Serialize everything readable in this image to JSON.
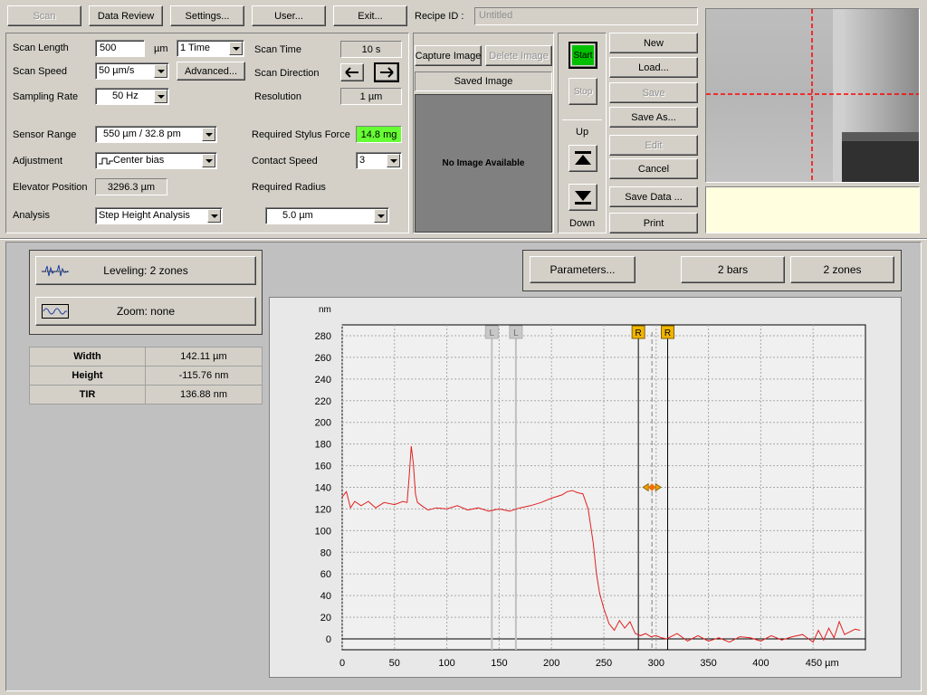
{
  "toolbar": {
    "scan": "Scan",
    "data_review": "Data Review",
    "settings": "Settings...",
    "user": "User...",
    "exit": "Exit...",
    "recipe_label": "Recipe ID :",
    "recipe_value": "Untitled"
  },
  "params": {
    "scan_length_label": "Scan Length",
    "scan_length_value": "500",
    "scan_length_unit": "µm",
    "repeat_value": "1 Time",
    "scan_speed_label": "Scan Speed",
    "scan_speed_value": "50 µm/s",
    "advanced": "Advanced...",
    "sampling_rate_label": "Sampling Rate",
    "sampling_rate_value": "50 Hz",
    "scan_time_label": "Scan Time",
    "scan_time_value": "10 s",
    "scan_direction_label": "Scan Direction",
    "resolution_label": "Resolution",
    "resolution_value": "1 µm",
    "sensor_range_label": "Sensor Range",
    "sensor_range_value": "550 µm / 32.8 pm",
    "adjustment_label": "Adjustment",
    "adjustment_value": "Center bias",
    "elevator_label": "Elevator Position",
    "elevator_value": "3296.3 µm",
    "analysis_label": "Analysis",
    "analysis_value": "Step Height Analysis",
    "stylus_force_label": "Required Stylus Force",
    "stylus_force_value": "14.8 mg",
    "contact_speed_label": "Contact Speed",
    "contact_speed_value": "3",
    "radius_label": "Required Radius",
    "radius_value": "5.0 µm"
  },
  "image": {
    "capture": "Capture Image",
    "delete": "Delete Image",
    "saved": "Saved Image",
    "no_image": "No Image Available"
  },
  "control": {
    "start": "Start",
    "stop": "Stop",
    "up": "Up",
    "down": "Down",
    "start_color": "#00c000"
  },
  "recipe_buttons": {
    "new": "New",
    "load": "Load...",
    "save": "Save",
    "save_as": "Save As...",
    "edit": "Edit",
    "cancel": "Cancel",
    "save_data": "Save Data ...",
    "print": "Print"
  },
  "analysis": {
    "leveling": "Leveling: 2 zones",
    "zoom": "Zoom: none",
    "parameters": "Parameters...",
    "bars": "2 bars",
    "zones": "2 zones"
  },
  "measurements": [
    {
      "name": "Width",
      "value": "142.11 µm"
    },
    {
      "name": "Height",
      "value": "-115.76 nm"
    },
    {
      "name": "TIR",
      "value": "136.88 nm"
    }
  ],
  "chart_data": {
    "type": "line",
    "ylabel": "nm",
    "xlabel": "µm",
    "xlim": [
      0,
      500
    ],
    "ylim": [
      -10,
      290
    ],
    "xticks": [
      0,
      50,
      100,
      150,
      200,
      250,
      300,
      350,
      400,
      450
    ],
    "xtick_labels": [
      "0",
      "50",
      "100",
      "150",
      "200",
      "250",
      "300",
      "350",
      "400",
      "450 µm"
    ],
    "yticks": [
      0,
      20,
      40,
      60,
      80,
      100,
      120,
      140,
      160,
      180,
      200,
      220,
      240,
      260,
      280
    ],
    "grid": true,
    "line_color": "#e02020",
    "markers": [
      {
        "label": "L",
        "x": 143,
        "color": "#c8c8c8"
      },
      {
        "label": "L",
        "x": 166,
        "color": "#c8c8c8"
      },
      {
        "label": "R",
        "x": 283,
        "color": "#f0b400"
      },
      {
        "label": "R",
        "x": 311,
        "color": "#f0b400"
      }
    ],
    "handle": {
      "x": 296,
      "y": 140
    },
    "series": [
      {
        "x": [
          0,
          4,
          8,
          12,
          18,
          25,
          32,
          40,
          50,
          58,
          62,
          64,
          66,
          68,
          70,
          72,
          76,
          82,
          90,
          100,
          110,
          120,
          130,
          140,
          150,
          160,
          170,
          180,
          190,
          200,
          210,
          215,
          220,
          225,
          230,
          235,
          240,
          243,
          246,
          250,
          255,
          260,
          265,
          270,
          275,
          280,
          285,
          290,
          295,
          300,
          305,
          310,
          320,
          330,
          340,
          350,
          360,
          370,
          380,
          390,
          400,
          410,
          420,
          430,
          440,
          450,
          455,
          460,
          465,
          470,
          475,
          480,
          490,
          495
        ],
        "y": [
          131,
          136,
          121,
          127,
          123,
          127,
          121,
          126,
          124,
          127,
          126,
          150,
          178,
          162,
          134,
          126,
          123,
          119,
          121,
          120,
          123,
          119,
          121,
          118,
          120,
          118,
          121,
          123,
          126,
          130,
          133,
          136,
          137,
          135,
          134,
          120,
          88,
          60,
          42,
          28,
          14,
          8,
          17,
          10,
          16,
          5,
          3,
          5,
          2,
          3,
          1,
          0,
          5,
          -2,
          3,
          -2,
          1,
          -3,
          2,
          1,
          -2,
          3,
          -1,
          2,
          4,
          -3,
          8,
          -1,
          10,
          1,
          16,
          4,
          9,
          8
        ]
      }
    ]
  }
}
